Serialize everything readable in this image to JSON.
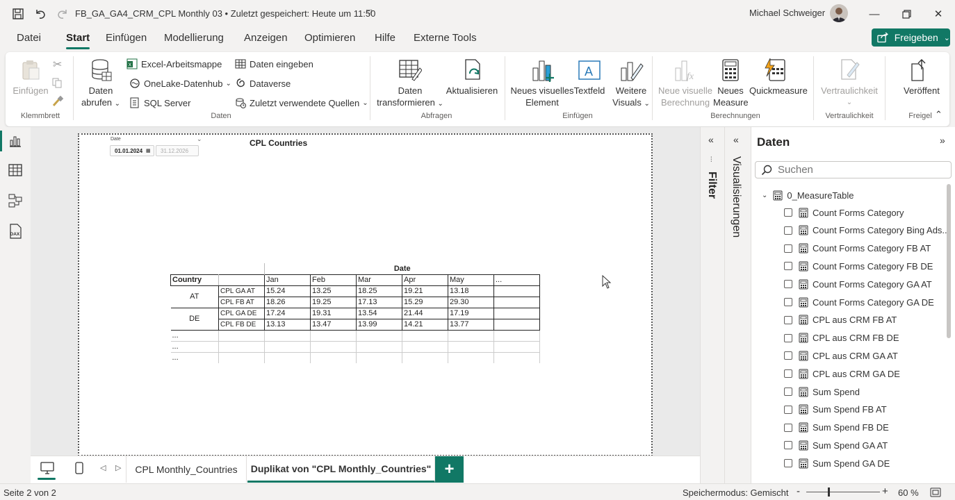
{
  "titlebar": {
    "doc_title": "FB_GA_GA4_CRM_CPL Monthly 03 • Zuletzt gespeichert: Heute um 11:50",
    "user_name": "Michael Schweiger"
  },
  "menu": {
    "items": [
      "Datei",
      "Start",
      "Einfügen",
      "Modellierung",
      "Anzeigen",
      "Optimieren",
      "Hilfe",
      "Externe Tools"
    ],
    "active": "Start",
    "share_label": "Freigeben"
  },
  "ribbon": {
    "clipboard": {
      "paste": "Einfügen",
      "group": "Klemmbrett"
    },
    "data": {
      "get_data_l1": "Daten",
      "get_data_l2": "abrufen",
      "excel": "Excel-Arbeitsmappe",
      "onelake": "OneLake-Datenhub",
      "sql": "SQL Server",
      "enter_data": "Daten eingeben",
      "dataverse": "Dataverse",
      "recent": "Zuletzt verwendete Quellen",
      "group": "Daten"
    },
    "queries": {
      "transform_l1": "Daten",
      "transform_l2": "transformieren",
      "refresh": "Aktualisieren",
      "group": "Abfragen"
    },
    "insert": {
      "new_visual_l1": "Neues visuelles",
      "new_visual_l2": "Element",
      "textbox": "Textfeld",
      "more_visuals_l1": "Weitere",
      "more_visuals_l2": "Visuals",
      "group": "Einfügen"
    },
    "calculations": {
      "new_calc_l1": "Neue visuelle",
      "new_calc_l2": "Berechnung",
      "new_measure_l1": "Neues",
      "new_measure_l2": "Measure",
      "quick_measure": "Quickmeasure",
      "group": "Berechnungen"
    },
    "sensitivity": {
      "label": "Vertraulichkeit",
      "group": "Vertraulichkeit"
    },
    "share": {
      "publish": "Veröffent",
      "group": "Freigel"
    }
  },
  "report": {
    "visual_title": "CPL Countries",
    "slicer_label": "Date",
    "date_from": "01.01.2024",
    "date_to": "31.12.2026",
    "matrix": {
      "col_header": "Date",
      "row_header": "Country",
      "months": [
        "Jan",
        "Feb",
        "Mar",
        "Apr",
        "May",
        "..."
      ],
      "rows": [
        {
          "country": "AT",
          "metric": "CPL GA AT",
          "values": [
            "15.24",
            "13.25",
            "18.25",
            "19.21",
            "13.18",
            ""
          ]
        },
        {
          "country": "",
          "metric": "CPL FB AT",
          "values": [
            "18.26",
            "19.25",
            "17.13",
            "15.29",
            "29.30",
            ""
          ]
        },
        {
          "country": "DE",
          "metric": "CPL GA DE",
          "values": [
            "17.24",
            "19.31",
            "13.54",
            "21.44",
            "17.19",
            ""
          ]
        },
        {
          "country": "",
          "metric": "CPL FB  DE",
          "values": [
            "13.13",
            "13.47",
            "13.99",
            "14.21",
            "13.77",
            ""
          ]
        }
      ],
      "ellipsis_rows": [
        "...",
        "...",
        "..."
      ]
    }
  },
  "panes": {
    "filter": "Filter",
    "visualizations": "Visualisierungen",
    "data_title": "Daten",
    "search_placeholder": "Suchen",
    "table_name": "0_MeasureTable",
    "fields": [
      "Count Forms Category",
      "Count Forms Category Bing Ads...",
      "Count Forms Category FB AT",
      "Count Forms Category FB DE",
      "Count Forms Category GA AT",
      "Count Forms Category GA DE",
      "CPL aus CRM FB AT",
      "CPL aus CRM FB DE",
      "CPL aus CRM GA AT",
      "CPL aus CRM GA DE",
      "Sum Spend",
      "Sum Spend FB AT",
      "Sum Spend FB DE",
      "Sum Spend GA AT",
      "Sum Spend GA DE"
    ]
  },
  "pages": {
    "tabs": [
      "CPL Monthly_Countries",
      "Duplikat von \"CPL Monthly_Countries\""
    ],
    "active_index": 1
  },
  "status": {
    "page_info": "Seite 2 von 2",
    "storage_mode": "Speichermodus: Gemischt",
    "zoom": "60 %",
    "zoom_level": 0.3
  },
  "colors": {
    "accent": "#117865",
    "ribbon_bg": "#ffffff",
    "chrome_bg": "#f3f2f1"
  }
}
